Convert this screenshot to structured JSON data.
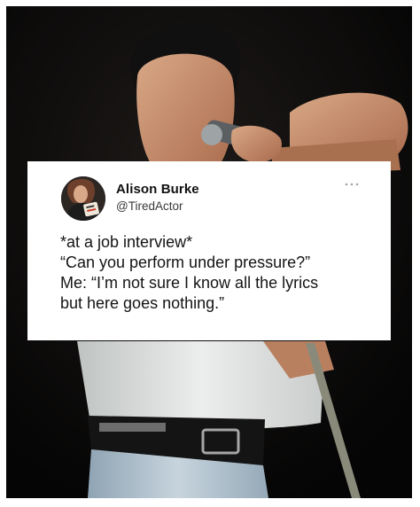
{
  "tweet": {
    "author_name": "Alison Burke",
    "author_handle": "@TiredActor",
    "more_icon": "more-horizontal-icon",
    "lines": [
      "*at a job interview*",
      "“Can you perform under pressure?”",
      "Me: “I’m not sure I know all the lyrics",
      "but here goes nothing.”"
    ]
  },
  "colors": {
    "photo_background": "#0b0b0b",
    "card_background": "#ffffff",
    "text": "#141414"
  }
}
